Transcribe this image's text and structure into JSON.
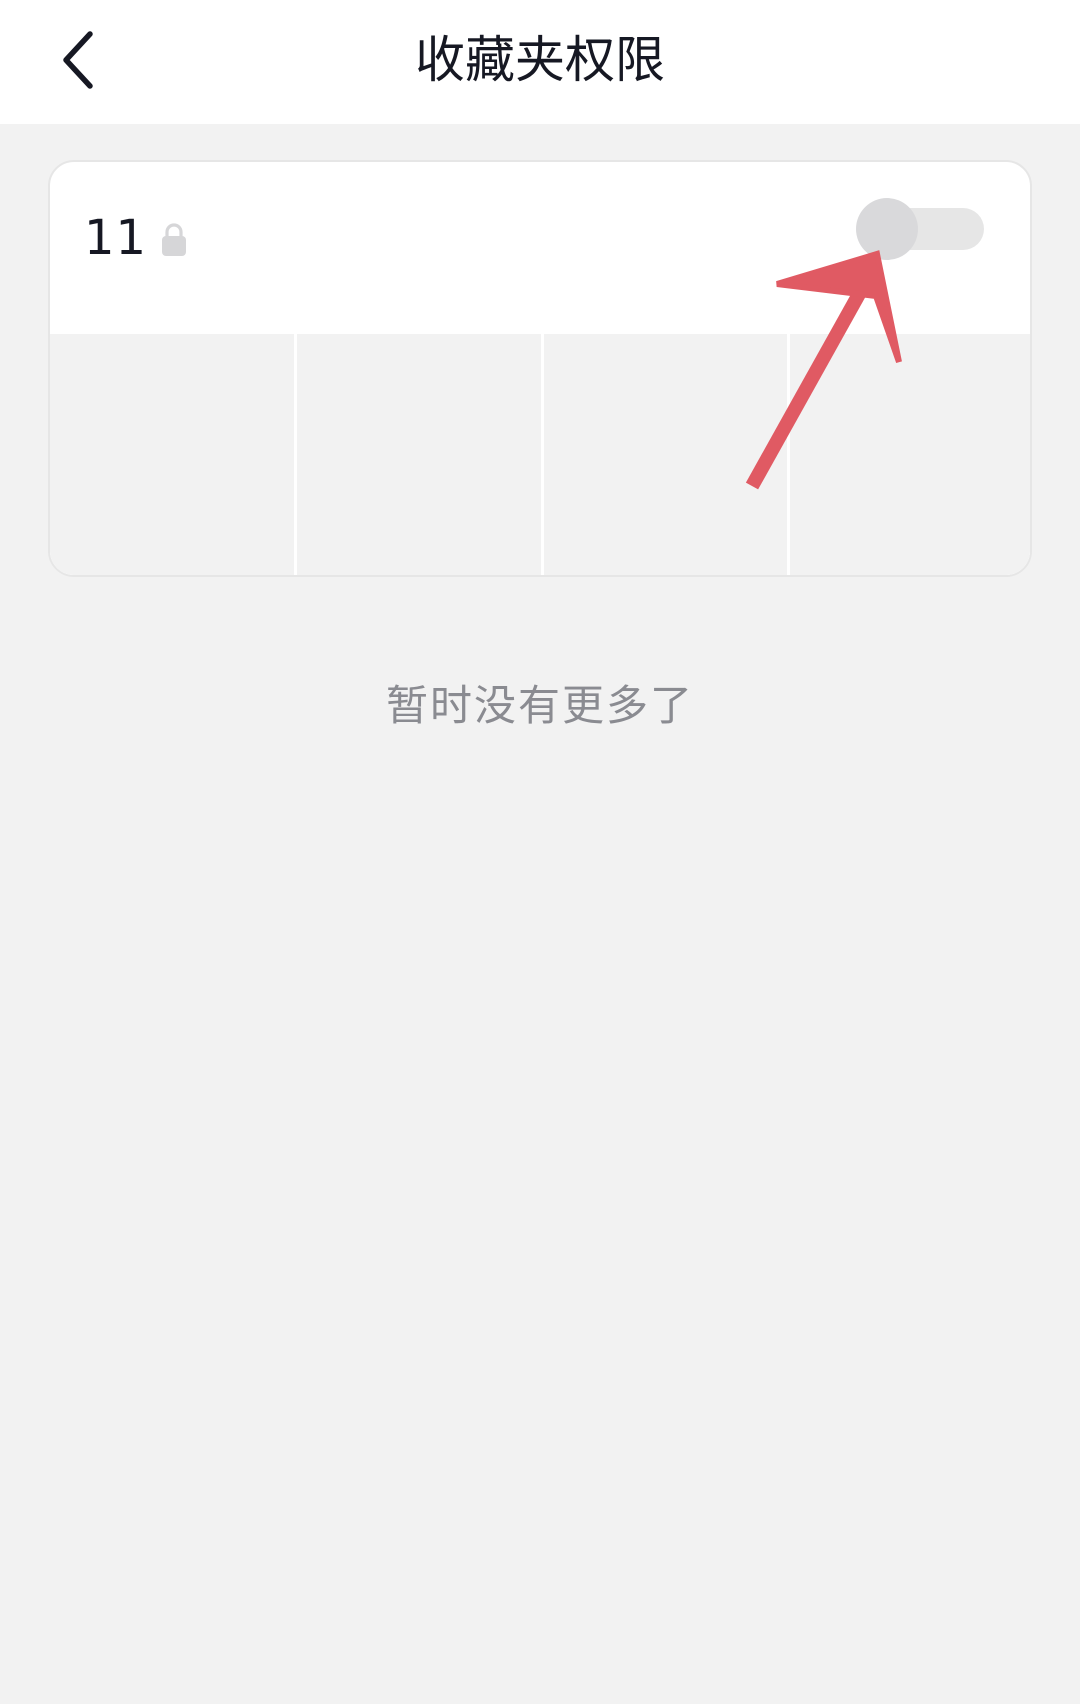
{
  "header": {
    "title": "收藏夹权限",
    "back_icon": "chevron-left-icon"
  },
  "folder_card": {
    "name": "11",
    "lock_icon": "lock-icon",
    "privacy_toggle": {
      "state": "off"
    },
    "thumbnail_count": 4
  },
  "empty_hint": "暂时没有更多了",
  "annotation": {
    "type": "arrow",
    "color": "#e05a63",
    "points_to": "privacy-toggle"
  },
  "colors": {
    "background": "#f2f2f2",
    "header_bg": "#ffffff",
    "title_text": "#161823",
    "hint_text": "#8a8b91",
    "toggle_track": "#e6e6e6",
    "toggle_knob": "#d9d9db",
    "lock_icon": "#d6d6d8",
    "arrow": "#e05a63"
  }
}
